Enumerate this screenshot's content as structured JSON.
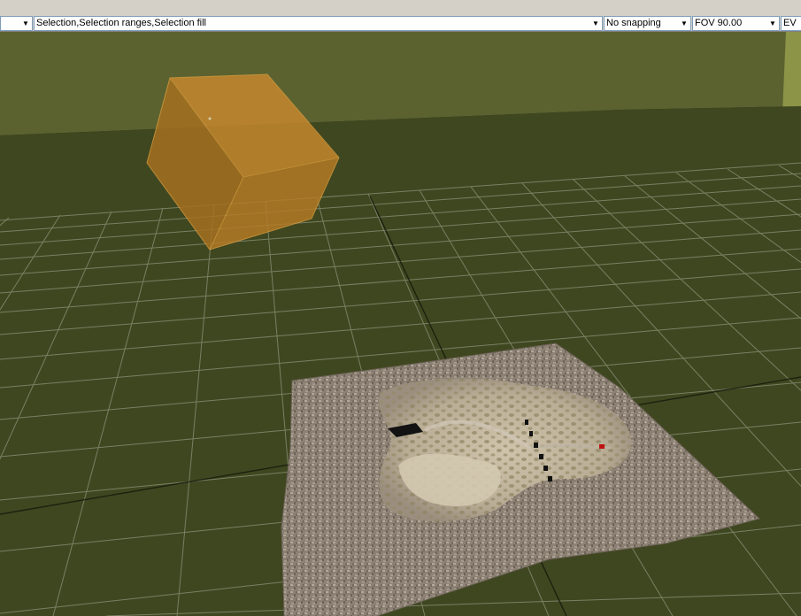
{
  "toolbar": {
    "left_combo_value": "",
    "selection_mode_value": "Selection,Selection ranges,Selection fill",
    "snapping_value": "No snapping",
    "fov_value": "FOV 90.00",
    "ev_value": "EV"
  },
  "icons": {
    "dropdown_arrow": "chevron-down-icon"
  },
  "colors": {
    "toolbar_bg": "#d4d0c8",
    "backdrop_wall": "#5b6230",
    "floor": "#3f4720",
    "grid_line": "#9ba18a",
    "selection_box": "#c88a2a",
    "terrain_rim": "#8f8478",
    "terrain_basin": "#c8bca4"
  }
}
